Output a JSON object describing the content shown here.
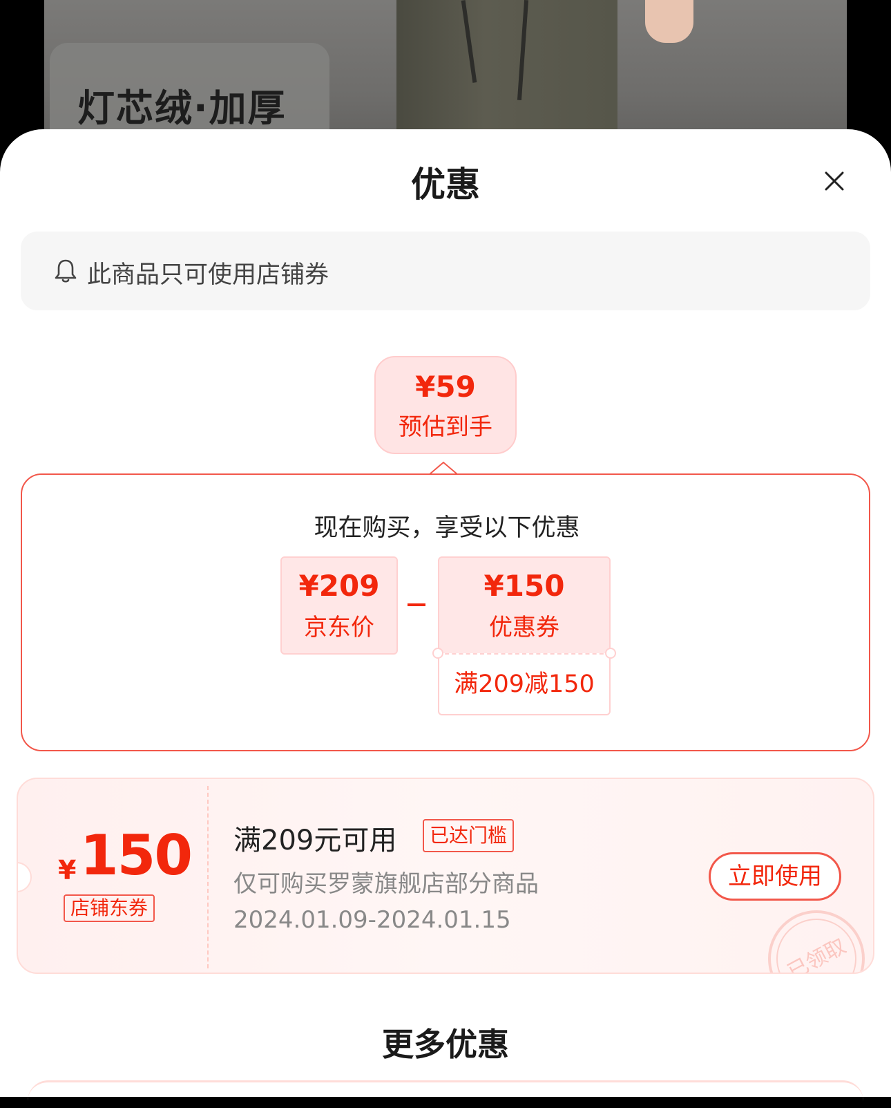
{
  "background": {
    "product_label": "灯芯绒·加厚"
  },
  "sheet": {
    "title": "优惠",
    "notice": "此商品只可使用店铺券"
  },
  "estimate": {
    "price": "¥59",
    "label": "预估到手"
  },
  "offer": {
    "heading": "现在购买，享受以下优惠",
    "price_amount": "¥209",
    "price_label": "京东价",
    "coupon_amount": "¥150",
    "coupon_label": "优惠券",
    "coupon_condition": "满209减150"
  },
  "coupon": {
    "currency": "¥",
    "amount": "150",
    "tag": "店铺东券",
    "title": "满209元可用",
    "badge": "已达门槛",
    "scope": "仅可购买罗蒙旗舰店部分商品",
    "validity": "2024.01.09-2024.01.15",
    "button": "立即使用",
    "stamp": "已领取"
  },
  "more": {
    "title": "更多优惠"
  },
  "colors": {
    "accent": "#f2270c",
    "light_pink": "#ffe7e7"
  }
}
